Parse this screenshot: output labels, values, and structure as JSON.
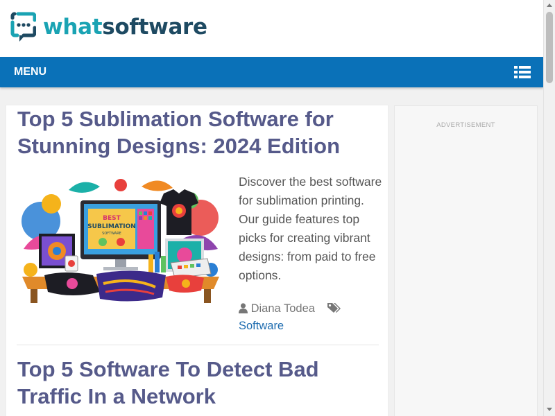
{
  "site": {
    "name_part1": "what",
    "name_part2": "software",
    "logo_icon": "speech-bubble-icon",
    "colors": {
      "accent": "#1aa3b3",
      "dark": "#1e4a62",
      "nav": "#0a71b8",
      "title": "#565a8a",
      "link": "#1f6db0"
    }
  },
  "nav": {
    "menu_label": "MENU",
    "menu_icon": "list-menu-icon"
  },
  "posts": [
    {
      "title": "Top 5 Sublimation Software for Stunning Designs: 2024 Edition",
      "excerpt": "Discover the best software for sublimation printing. Our guide features top picks for creating vibrant designs: from paid to free options.",
      "author": "Diana Todea",
      "category": "Software",
      "image_text_1": "BEST",
      "image_text_2": "SUBLIMATION",
      "image_text_3": "SOFTWARE"
    },
    {
      "title": "Top 5 Software To Detect Bad Traffic In a Network"
    }
  ],
  "sidebar": {
    "ad_label": "ADVERTISEMENT"
  }
}
